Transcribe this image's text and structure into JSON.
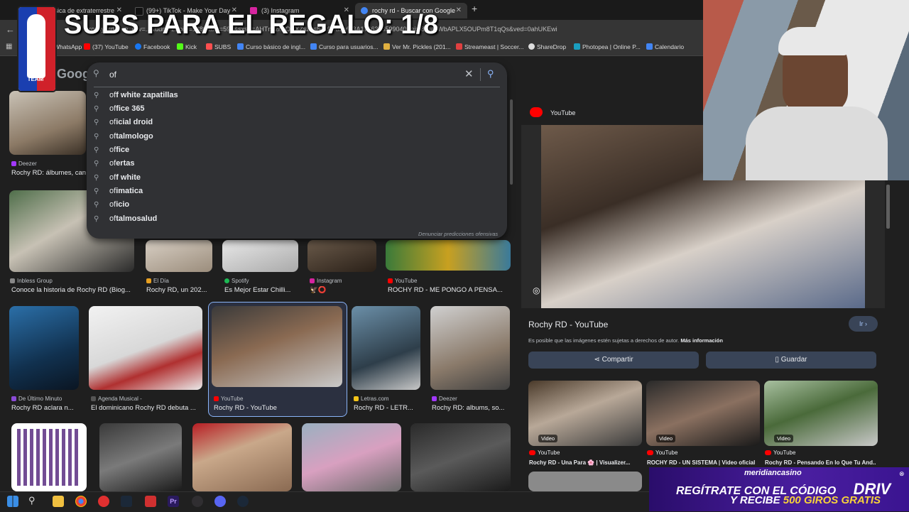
{
  "overlay": {
    "title": "SUBS PARA EL REGALO: 1/8",
    "logo_text": "DRIV\nTEAM"
  },
  "tabs": [
    {
      "label": "musica de extraterrestre",
      "color": "#ff0000"
    },
    {
      "label": "(99+) TikTok - Make Your Day",
      "color": "#111111"
    },
    {
      "label": "(3) Instagram",
      "color": "#d6249f"
    },
    {
      "label": "rochy rd - Buscar con Google",
      "color": "#4285f4",
      "active": true
    }
  ],
  "address_bar": {
    "url": "=rochy+rd&sca_esv=...&udm=2&biw=1280&bih=593&sxsrf=AHTn8zr...ORXZszIrs8dL9wdJw%3A1766376599040&ei=l8RIacWbAPLX5OUPm8T1qQs&ved=0ahUKEwi"
  },
  "bookmarks": [
    {
      "label": "WhatsApp",
      "color": "#25d366"
    },
    {
      "label": "(37) YouTube",
      "color": "#ff0000"
    },
    {
      "label": "Facebook",
      "color": "#1877f2"
    },
    {
      "label": "Kick",
      "color": "#53fc18"
    },
    {
      "label": "SUBS",
      "color": "#ff4f4f"
    },
    {
      "label": "Curso básico de ingl...",
      "color": "#4285f4"
    },
    {
      "label": "Curso para usuarios...",
      "color": "#4285f4"
    },
    {
      "label": "Ver Mr. Pickles (201...",
      "color": "#e0b040"
    },
    {
      "label": "Streameast | Soccer...",
      "color": "#e04040"
    },
    {
      "label": "ShareDrop",
      "color": "#dddddd"
    },
    {
      "label": "Photopea | Online P...",
      "color": "#1a9ebf"
    },
    {
      "label": "Calendario",
      "color": "#4285f4"
    }
  ],
  "search": {
    "logo": "Google",
    "query": "of",
    "suggestions": [
      {
        "prefix": "of",
        "rest": "f white zapatillas"
      },
      {
        "prefix": "of",
        "rest": "fice 365"
      },
      {
        "prefix": "of",
        "rest": "icial droid"
      },
      {
        "prefix": "of",
        "rest": "talmologo"
      },
      {
        "prefix": "of",
        "rest": "fice"
      },
      {
        "prefix": "of",
        "rest": "ertas"
      },
      {
        "prefix": "of",
        "rest": "f white"
      },
      {
        "prefix": "of",
        "rest": "imatica"
      },
      {
        "prefix": "of",
        "rest": "icio"
      },
      {
        "prefix": "of",
        "rest": "talmosalud"
      }
    ],
    "report_label": "Denunciar predicciones ofensivas"
  },
  "results_row1": [
    {
      "source": "Deezer",
      "caption": "Rochy RD: álbumes, can",
      "color": "#a238ff"
    }
  ],
  "results_row2": [
    {
      "source": "Inbless Group",
      "caption": "Conoce la historia de Rochy RD (Biog...",
      "color": "#888888"
    },
    {
      "source": "El Día",
      "caption": "Rochy RD, un 202...",
      "color": "#e8a020"
    },
    {
      "source": "Spotify",
      "caption": "Es Mejor Estar Chilli...",
      "color": "#1db954"
    },
    {
      "source": "Instagram",
      "caption": "🦅⭕",
      "color": "#d6249f"
    },
    {
      "source": "YouTube",
      "caption": "ROCHY RD - ME PONGO A PENSA...",
      "color": "#ff0000"
    }
  ],
  "results_row3": [
    {
      "source": "De Último Minuto",
      "caption": "Rochy RD aclara n...",
      "color": "#8a4bd6"
    },
    {
      "source": "Agenda Musical -",
      "caption": "El dominicano Rochy RD debuta ...",
      "color": "#555555"
    },
    {
      "source": "YouTube",
      "caption": "Rochy RD - YouTube",
      "color": "#ff0000"
    },
    {
      "source": "Letras.com",
      "caption": "Rochy RD - LETR...",
      "color": "#f5c518"
    },
    {
      "source": "Deezer",
      "caption": "Rochy RD: albums, so...",
      "color": "#a238ff"
    }
  ],
  "panel": {
    "source": "YouTube",
    "title": "Rochy RD - YouTube",
    "open_label": "Ir",
    "notice": "Es posible que las imágenes estén sujetas a derechos de autor.",
    "notice_link": "Más información",
    "share_label": "Compartir",
    "save_label": "Guardar",
    "related": [
      {
        "badge": "Video",
        "source": "YouTube",
        "caption": "Rochy RD - Una Para 🌸 | Visualizer..."
      },
      {
        "badge": "Video",
        "source": "YouTube",
        "caption": "ROCHY RD - UN SISTEMA | Video oficial"
      },
      {
        "badge": "Video",
        "source": "YouTube",
        "caption": "Rochy RD - Pensando En lo Que Tu And..."
      }
    ]
  },
  "casino": {
    "name": "meridiancasino",
    "line1": "REGÍTRATE CON EL CÓDIGO",
    "code": "DRIV",
    "line2_a": "Y RECIBE",
    "line2_b": "500 GIROS GRATIS"
  },
  "taskbar": [
    "start",
    "search",
    "files",
    "chrome",
    "music",
    "steam",
    "video",
    "premiere",
    "obs",
    "app",
    "steam2"
  ]
}
